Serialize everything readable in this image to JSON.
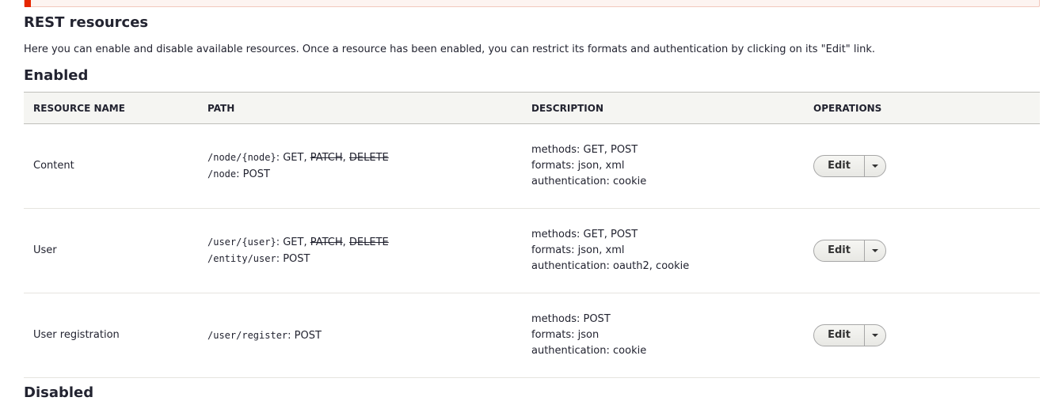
{
  "page": {
    "title": "REST resources",
    "intro": "Here you can enable and disable available resources. Once a resource has been enabled, you can restrict its formats and authentication by clicking on its \"Edit\" link."
  },
  "enabled": {
    "title": "Enabled",
    "columns": {
      "name": "Resource name",
      "path": "Path",
      "description": "Description",
      "operations": "Operations"
    },
    "rows": [
      {
        "name": "Content",
        "paths": [
          {
            "path": "/node/{node}",
            "sep": ": ",
            "methods": [
              {
                "label": "GET",
                "struck": false
              },
              {
                "label": "PATCH",
                "struck": true
              },
              {
                "label": "DELETE",
                "struck": true
              }
            ]
          },
          {
            "path": "/node",
            "sep": ": ",
            "methods": [
              {
                "label": "POST",
                "struck": false
              }
            ]
          }
        ],
        "description": {
          "methods": "methods: GET, POST",
          "formats": "formats: json, xml",
          "authentication": "authentication: cookie"
        },
        "operation": "Edit"
      },
      {
        "name": "User",
        "paths": [
          {
            "path": "/user/{user}",
            "sep": ": ",
            "methods": [
              {
                "label": "GET",
                "struck": false
              },
              {
                "label": "PATCH",
                "struck": true
              },
              {
                "label": "DELETE",
                "struck": true
              }
            ]
          },
          {
            "path": "/entity/user",
            "sep": ": ",
            "methods": [
              {
                "label": "POST",
                "struck": false
              }
            ]
          }
        ],
        "description": {
          "methods": "methods: GET, POST",
          "formats": "formats: json, xml",
          "authentication": "authentication: oauth2, cookie"
        },
        "operation": "Edit"
      },
      {
        "name": "User registration",
        "paths": [
          {
            "path": "/user/register",
            "sep": ": ",
            "methods": [
              {
                "label": "POST",
                "struck": false
              }
            ]
          }
        ],
        "description": {
          "methods": "methods: POST",
          "formats": "formats: json",
          "authentication": "authentication: cookie"
        },
        "operation": "Edit"
      }
    ]
  },
  "disabled": {
    "title": "Disabled"
  },
  "icons": {
    "dropdown_toggle": "chevron-down-icon"
  },
  "colors": {
    "alert_accent": "#e62600",
    "header_bg": "#f5f5f2",
    "text": "#222330"
  }
}
